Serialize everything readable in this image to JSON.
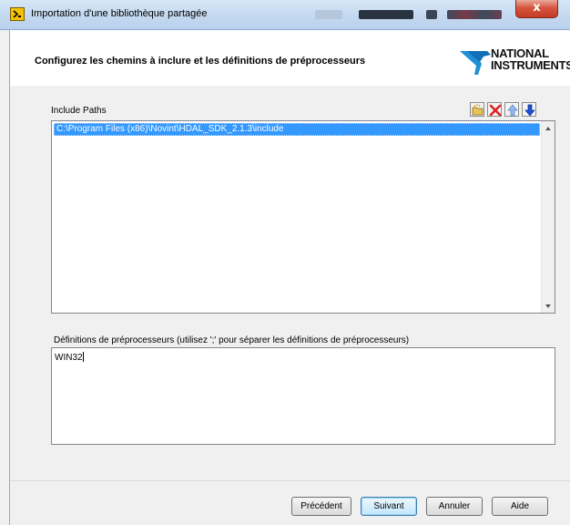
{
  "window": {
    "title": "Importation d'une bibliothèque partagée",
    "close_glyph": "x"
  },
  "header": {
    "title": "Configurez les chemins à inclure et les définitions de préprocesseurs",
    "logo_line1": "NATIONAL",
    "logo_line2": "INSTRUMENTS"
  },
  "include_paths": {
    "label": "Include Paths",
    "items": [
      "C:\\Program Files (x86)\\Novint\\HDAL_SDK_2.1.3\\include"
    ],
    "toolbar_icons": [
      "browse-folder-icon",
      "delete-icon",
      "move-up-icon",
      "move-down-icon"
    ]
  },
  "definitions": {
    "label": "Définitions de préprocesseurs (utilisez ';' pour séparer les définitions de préprocesseurs)",
    "value": "WIN32"
  },
  "buttons": {
    "previous": "Précédent",
    "next": "Suivant",
    "cancel": "Annuler",
    "help": "Aide"
  },
  "colors": {
    "selection": "#3399ff",
    "logo_blue": "#1f8fd6"
  }
}
